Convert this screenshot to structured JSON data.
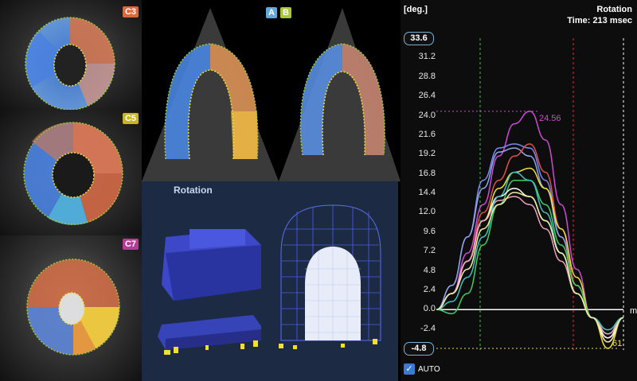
{
  "views": {
    "c3": {
      "label": "C3",
      "color": "#d86a3c"
    },
    "c5": {
      "label": "C5",
      "color": "#c8b42a"
    },
    "c7": {
      "label": "C7",
      "color": "#b43c94"
    },
    "a": {
      "label": "A",
      "color": "#5fa8e0"
    },
    "b": {
      "label": "B",
      "color": "#a8c83a"
    }
  },
  "model_panel": {
    "title": "Rotation"
  },
  "graph": {
    "unit": "[deg.]",
    "title": "Rotation",
    "time": "Time: 213 msec",
    "max_box": "33.6",
    "min_box": "-4.8",
    "ticks": [
      "31.2",
      "28.8",
      "26.4",
      "24.0",
      "21.6",
      "19.2",
      "16.8",
      "14.4",
      "12.0",
      "9.6",
      "7.2",
      "4.8",
      "2.4",
      "0.0",
      "-2.4"
    ],
    "peak_label": "24.56",
    "min_label": "61",
    "auto_label": "AUTO",
    "edge_label": "m"
  },
  "chart_data": {
    "type": "line",
    "title": "Rotation",
    "ylabel": "[deg.]",
    "ylim": [
      -4.8,
      33.6
    ],
    "yticks": [
      -2.4,
      0.0,
      2.4,
      4.8,
      7.2,
      9.6,
      12.0,
      14.4,
      16.8,
      19.2,
      21.6,
      24.0,
      26.4,
      28.8,
      31.2
    ],
    "annotations": [
      "24.56",
      "Time: 213 msec"
    ],
    "series": [
      {
        "color": "#d04ad8",
        "values": [
          0,
          2,
          7,
          13,
          19,
          23,
          24.56,
          21,
          13,
          5,
          -1,
          -4,
          -1
        ]
      },
      {
        "color": "#7a8cf0",
        "values": [
          0,
          3,
          9,
          16,
          20,
          20.5,
          20,
          16,
          9,
          3,
          -1,
          -3,
          -1
        ]
      },
      {
        "color": "#8fa6e8",
        "values": [
          0,
          3,
          9,
          15,
          19.5,
          20,
          19,
          15,
          9,
          3,
          -1,
          -2.5,
          -1
        ]
      },
      {
        "color": "#e05050",
        "values": [
          0,
          2,
          6,
          12,
          16,
          19,
          20.5,
          17,
          10,
          3,
          -1,
          -3.5,
          -1
        ]
      },
      {
        "color": "#f0e040",
        "values": [
          0,
          2,
          6,
          11,
          15,
          17,
          17.5,
          15,
          10,
          4,
          -1,
          -4.8,
          -1
        ]
      },
      {
        "color": "#40d060",
        "values": [
          0,
          -0.5,
          2,
          8,
          13,
          16,
          16,
          13,
          8,
          3,
          -1,
          -3,
          -1
        ]
      },
      {
        "color": "#ffffff",
        "values": [
          0,
          2,
          6,
          11,
          14,
          15,
          14,
          11,
          7,
          2,
          -1,
          -3.5,
          -1
        ]
      },
      {
        "color": "#f0a0c0",
        "values": [
          0,
          2,
          6,
          11,
          13.5,
          14,
          13,
          10,
          6,
          2,
          -1,
          -3,
          -1
        ]
      },
      {
        "color": "#40c0c0",
        "values": [
          0,
          1,
          4,
          9,
          14,
          17,
          16,
          12,
          7,
          2,
          -1,
          -2.5,
          -1
        ]
      },
      {
        "color": "#f0f0a0",
        "values": [
          0,
          2,
          5,
          10,
          13,
          14.5,
          14,
          11,
          7,
          2,
          -1,
          -4,
          -1
        ]
      }
    ]
  }
}
